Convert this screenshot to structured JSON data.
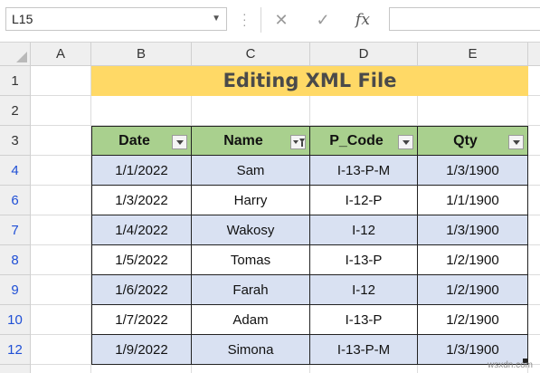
{
  "formula_bar": {
    "name_box": "L15",
    "cancel_icon": "✕",
    "enter_icon": "✓",
    "fx_label": "fx",
    "formula_value": ""
  },
  "columns": [
    "A",
    "B",
    "C",
    "D",
    "E"
  ],
  "rows": [
    "1",
    "2",
    "3",
    "4",
    "6",
    "7",
    "8",
    "9",
    "10",
    "12"
  ],
  "title": "Editing XML File",
  "table": {
    "headers": [
      "Date",
      "Name",
      "P_Code",
      "Qty"
    ],
    "filtered_column": "Name",
    "data": [
      [
        "1/1/2022",
        "Sam",
        "I-13-P-M",
        "1/3/1900"
      ],
      [
        "1/3/2022",
        "Harry",
        "I-12-P",
        "1/1/1900"
      ],
      [
        "1/4/2022",
        "Wakosy",
        "I-12",
        "1/3/1900"
      ],
      [
        "1/5/2022",
        "Tomas",
        "I-13-P",
        "1/2/1900"
      ],
      [
        "1/6/2022",
        "Farah",
        "I-12",
        "1/2/1900"
      ],
      [
        "1/7/2022",
        "Adam",
        "I-13-P",
        "1/2/1900"
      ],
      [
        "1/9/2022",
        "Simona",
        "I-13-P-M",
        "1/3/1900"
      ]
    ]
  },
  "colors": {
    "title_fill": "#ffd966",
    "header_fill": "#a9d08e",
    "band_fill": "#d9e1f2",
    "filtered_row_number": "#1f4fd6"
  },
  "watermark": "wsxdn.com"
}
